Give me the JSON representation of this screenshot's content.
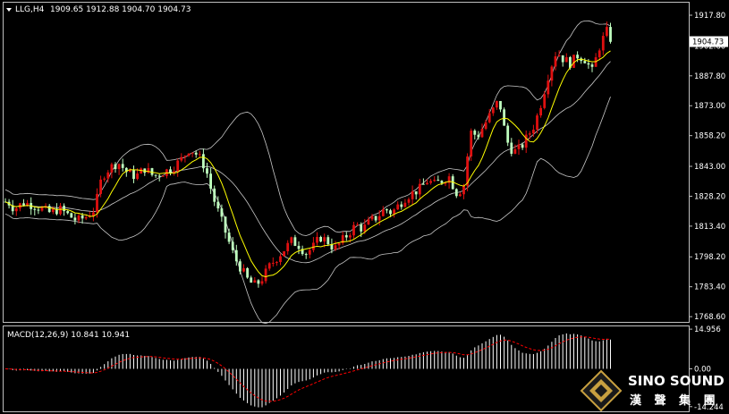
{
  "chart_data": [
    {
      "type": "candlestick",
      "symbol_label": "LLG,H4",
      "ohlc_header": [
        "1909.65",
        "1912.88",
        "1904.70",
        "1904.73"
      ],
      "last_price_label": "1904.73",
      "last_price": 1904.73,
      "y_ticks": [
        1917.8,
        1902.6,
        1887.8,
        1873.0,
        1858.2,
        1843.0,
        1828.2,
        1813.4,
        1798.2,
        1783.4,
        1768.6
      ],
      "y_tick_labels": [
        "1917.80",
        "1902.60",
        "1887.80",
        "1873.00",
        "1858.20",
        "1843.00",
        "1828.20",
        "1813.40",
        "1798.20",
        "1783.40",
        "1768.60"
      ],
      "ylim": [
        1766,
        1924
      ],
      "up_color": "#e01010",
      "down_color": "#bfffbf",
      "ma_color": "#ffff00",
      "band_color": "#c8c8c8",
      "price_path": [
        [
          0,
          1824
        ],
        [
          8,
          1826
        ],
        [
          16,
          1822
        ],
        [
          26,
          1825
        ],
        [
          36,
          1824
        ],
        [
          46,
          1822
        ],
        [
          56,
          1820
        ],
        [
          66,
          1822
        ],
        [
          76,
          1819
        ],
        [
          86,
          1816
        ],
        [
          96,
          1818
        ],
        [
          106,
          1822
        ],
        [
          114,
          1838
        ],
        [
          122,
          1842
        ],
        [
          132,
          1845
        ],
        [
          142,
          1840
        ],
        [
          152,
          1838
        ],
        [
          162,
          1842
        ],
        [
          172,
          1838
        ],
        [
          182,
          1840
        ],
        [
          192,
          1842
        ],
        [
          202,
          1846
        ],
        [
          212,
          1852
        ],
        [
          222,
          1848
        ],
        [
          230,
          1842
        ],
        [
          238,
          1828
        ],
        [
          246,
          1818
        ],
        [
          254,
          1808
        ],
        [
          262,
          1798
        ],
        [
          270,
          1792
        ],
        [
          278,
          1786
        ],
        [
          286,
          1784
        ],
        [
          294,
          1788
        ],
        [
          302,
          1794
        ],
        [
          310,
          1798
        ],
        [
          318,
          1802
        ],
        [
          326,
          1806
        ],
        [
          334,
          1804
        ],
        [
          342,
          1800
        ],
        [
          350,
          1803
        ],
        [
          358,
          1808
        ],
        [
          366,
          1806
        ],
        [
          374,
          1802
        ],
        [
          382,
          1806
        ],
        [
          390,
          1810
        ],
        [
          398,
          1814
        ],
        [
          406,
          1812
        ],
        [
          414,
          1816
        ],
        [
          422,
          1818
        ],
        [
          430,
          1822
        ],
        [
          438,
          1820
        ],
        [
          446,
          1824
        ],
        [
          454,
          1828
        ],
        [
          462,
          1830
        ],
        [
          470,
          1832
        ],
        [
          478,
          1836
        ],
        [
          486,
          1834
        ],
        [
          494,
          1836
        ],
        [
          502,
          1838
        ],
        [
          510,
          1830
        ],
        [
          518,
          1832
        ],
        [
          526,
          1860
        ],
        [
          534,
          1858
        ],
        [
          542,
          1864
        ],
        [
          550,
          1870
        ],
        [
          558,
          1876
        ],
        [
          566,
          1856
        ],
        [
          574,
          1850
        ],
        [
          582,
          1852
        ],
        [
          590,
          1858
        ],
        [
          598,
          1864
        ],
        [
          606,
          1876
        ],
        [
          614,
          1890
        ],
        [
          622,
          1900
        ],
        [
          630,
          1896
        ],
        [
          638,
          1894
        ],
        [
          646,
          1898
        ],
        [
          654,
          1896
        ],
        [
          662,
          1890
        ],
        [
          670,
          1902
        ],
        [
          678,
          1910
        ],
        [
          684,
          1905
        ]
      ]
    },
    {
      "type": "histogram",
      "indicator_label": "MACD(12,26,9) 10.841 10.941",
      "y_ticks": [
        14.956,
        0.0,
        -14.244
      ],
      "y_tick_labels": [
        "14.956",
        "0.00",
        "-14.244"
      ],
      "ylim": [
        -16,
        16
      ],
      "hist_color": "#ffffff",
      "signal_color": "#ff0000"
    }
  ],
  "logo": {
    "title": "SINO SOUND",
    "subtitle": "漢 聲 集 團",
    "gold": "#c8a040"
  }
}
